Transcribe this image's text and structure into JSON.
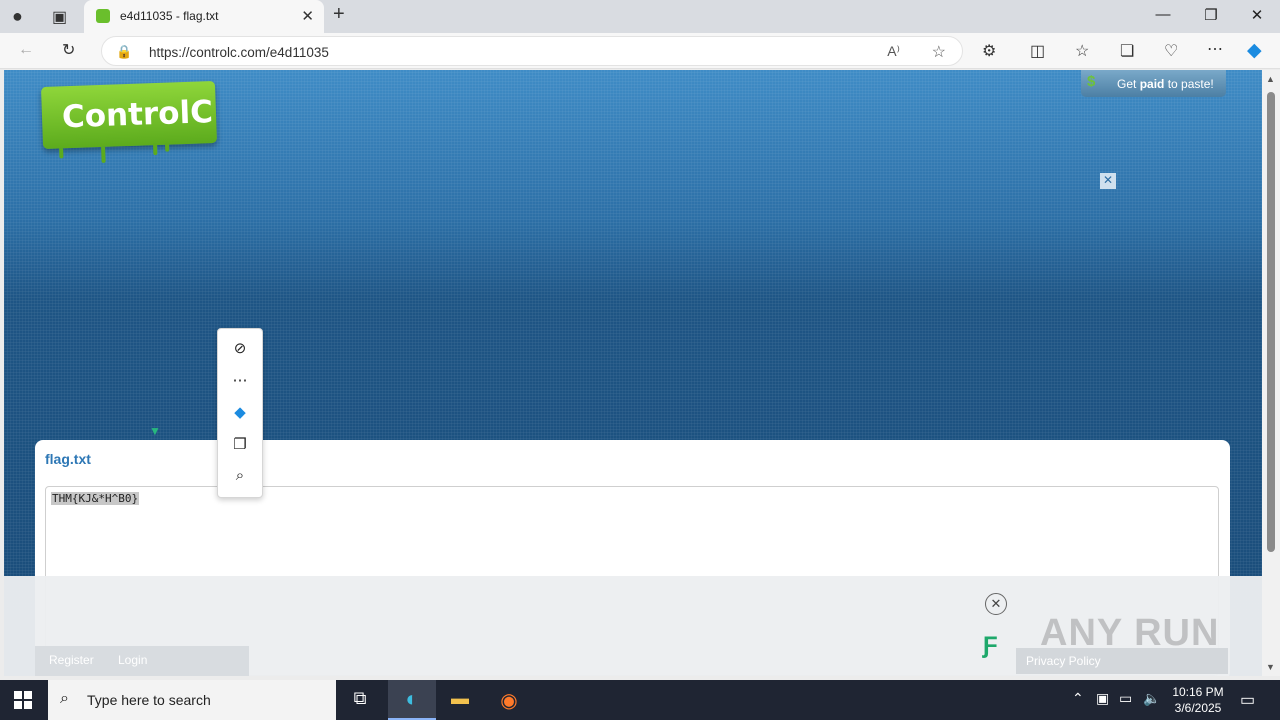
{
  "browser": {
    "tab_title": "e4d11035 - flag.txt",
    "tab_close": "✕",
    "new_tab": "+",
    "url": "https://controlc.com/e4d11035",
    "window_buttons": {
      "minimize": "—",
      "restore": "❐",
      "close": "✕"
    }
  },
  "page": {
    "logo_text": "ControlC",
    "get_paid_prefix": "Get ",
    "get_paid_bold": "paid",
    "get_paid_suffix": " to paste!",
    "ad_close": "✕",
    "file_name": "flag.txt",
    "file_content": "THM{KJ&*H^B0}",
    "footer_links": [
      "Register",
      "Login"
    ],
    "footer_right": "Privacy Policy"
  },
  "context_menu": {
    "items": [
      "hide-icon",
      "more-icon",
      "copilot-icon",
      "copy-icon",
      "search-icon"
    ]
  },
  "watermark": "ANY RUN",
  "taskbar": {
    "search_placeholder": "Type here to search",
    "time": "10:16 PM",
    "date": "3/6/2025"
  },
  "colors": {
    "page_bg_top": "#3f8cc6",
    "page_bg_bottom": "#1a4c79",
    "logo_green": "#6abf2c",
    "filename_blue": "#2d77b5",
    "taskbar": "#1f2533"
  }
}
